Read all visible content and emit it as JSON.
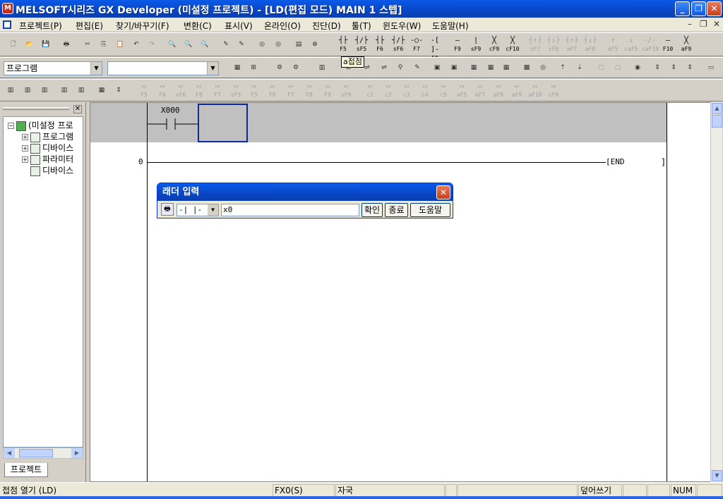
{
  "window": {
    "title": "MELSOFT시리즈 GX Developer (미설정 프로젝트) - [LD(편집 모드)     MAIN     1 스텝]",
    "app_icon": "melsoft-app-icon"
  },
  "menu": {
    "items": [
      "프로젝트(P)",
      "편집(E)",
      "찾기/바꾸기(F)",
      "변환(C)",
      "표시(V)",
      "온라인(O)",
      "진단(D)",
      "툴(T)",
      "윈도우(W)",
      "도움말(H)"
    ]
  },
  "toolbar1": {
    "fkeys": [
      {
        "sym": "┤├",
        "lbl": "F5",
        "enabled": true
      },
      {
        "sym": "┤/├",
        "lbl": "sF5",
        "enabled": true
      },
      {
        "sym": "┤├",
        "lbl": "F6",
        "enabled": true
      },
      {
        "sym": "┤/├",
        "lbl": "sF6",
        "enabled": true
      },
      {
        "sym": "-○-",
        "lbl": "F7",
        "enabled": true
      },
      {
        "sym": "-[ ]-",
        "lbl": "F8",
        "enabled": true
      },
      {
        "sym": "—",
        "lbl": "F9",
        "enabled": true
      },
      {
        "sym": "|",
        "lbl": "sF9",
        "enabled": true
      },
      {
        "sym": "╳",
        "lbl": "cF9",
        "enabled": true
      },
      {
        "sym": "╳",
        "lbl": "cF10",
        "enabled": true
      },
      {
        "sym": "┤↑├",
        "lbl": "sF7",
        "enabled": false
      },
      {
        "sym": "┤↓├",
        "lbl": "sF8",
        "enabled": false
      },
      {
        "sym": "┤↑├",
        "lbl": "aF7",
        "enabled": false
      },
      {
        "sym": "┤↓├",
        "lbl": "aF8",
        "enabled": false
      },
      {
        "sym": "↑",
        "lbl": "aF5",
        "enabled": false
      },
      {
        "sym": "↓",
        "lbl": "caF5",
        "enabled": false
      },
      {
        "sym": "-/-",
        "lbl": "caF10",
        "enabled": false
      },
      {
        "sym": "—",
        "lbl": "F10",
        "enabled": true
      },
      {
        "sym": "╳",
        "lbl": "aF9",
        "enabled": true
      }
    ]
  },
  "toolbar2": {
    "data_type_combo": "프로그램",
    "program_combo": "",
    "tooltip": "a접점"
  },
  "toolbar3": {
    "fkeys": [
      "F5",
      "F6",
      "sF6",
      "F8",
      "F7",
      "sF5",
      "F5",
      "F6",
      "F7",
      "F8",
      "F9",
      "sF9",
      "c1",
      "c2",
      "c3",
      "c4",
      "c5",
      "aF5",
      "aF7",
      "aF8",
      "aF9",
      "aF10",
      "cF9"
    ]
  },
  "project_pane": {
    "tree": {
      "root": "(미설정 프로",
      "children": [
        "프로그램",
        "디바이스",
        "파라미터",
        "디바이스"
      ]
    },
    "tab": "프로젝트"
  },
  "ladder": {
    "device_label": "X000",
    "step_number": "0",
    "end_label": "END"
  },
  "dialog": {
    "title": "래더 입력",
    "instruction_type": "-| |-",
    "input_value": "x0",
    "ok_label": "확인",
    "exit_label": "종료",
    "help_label": "도움말"
  },
  "statusbar": {
    "message": "접점 열기 (LD)",
    "cpu": "FX0(S)",
    "station": "자국",
    "mode": "덮어쓰기",
    "num": "NUM"
  },
  "colors": {
    "titlebar": "#0a5ae8",
    "selection_band": "#c0c0c0",
    "cursor": "#0a2a9a"
  }
}
